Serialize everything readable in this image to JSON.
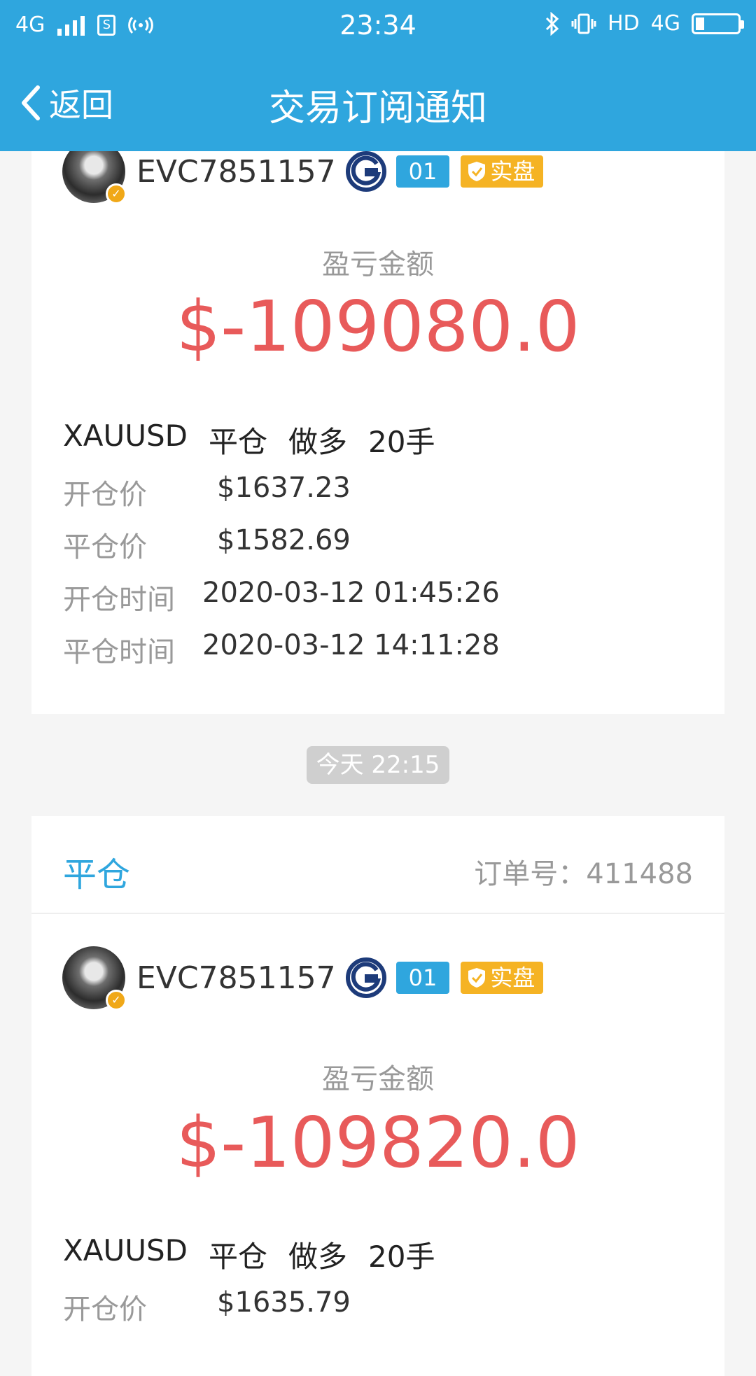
{
  "status_bar": {
    "network": "4G",
    "time": "23:34",
    "hd": "HD",
    "net_right": "4G",
    "battery_level": 0.18
  },
  "nav": {
    "back_label": "返回",
    "title": "交易订阅通知"
  },
  "records": [
    {
      "username": "EVC7851157",
      "level_badge": "01",
      "account_badge": "实盘",
      "pl_label": "盈亏金额",
      "pl_amount": "$-109080.0",
      "symbol": "XAUUSD",
      "action": "平仓",
      "direction": "做多",
      "lots": "20手",
      "open_price_label": "开仓价",
      "open_price": "$1637.23",
      "close_price_label": "平仓价",
      "close_price": "$1582.69",
      "open_time_label": "开仓时间",
      "open_time": "2020-03-12 01:45:26",
      "close_time_label": "平仓时间",
      "close_time": "2020-03-12 14:11:28"
    },
    {
      "timestamp": "今天 22:15",
      "type": "平仓",
      "order_label": "订单号：",
      "order_no": "411488",
      "username": "EVC7851157",
      "level_badge": "01",
      "account_badge": "实盘",
      "pl_label": "盈亏金额",
      "pl_amount": "$-109820.0",
      "symbol": "XAUUSD",
      "action": "平仓",
      "direction": "做多",
      "lots": "20手",
      "open_price_label": "开仓价",
      "open_price": "$1635.79"
    }
  ],
  "colors": {
    "accent": "#2fa6de",
    "loss": "#e85a5a",
    "gold_badge": "#f5b324"
  }
}
